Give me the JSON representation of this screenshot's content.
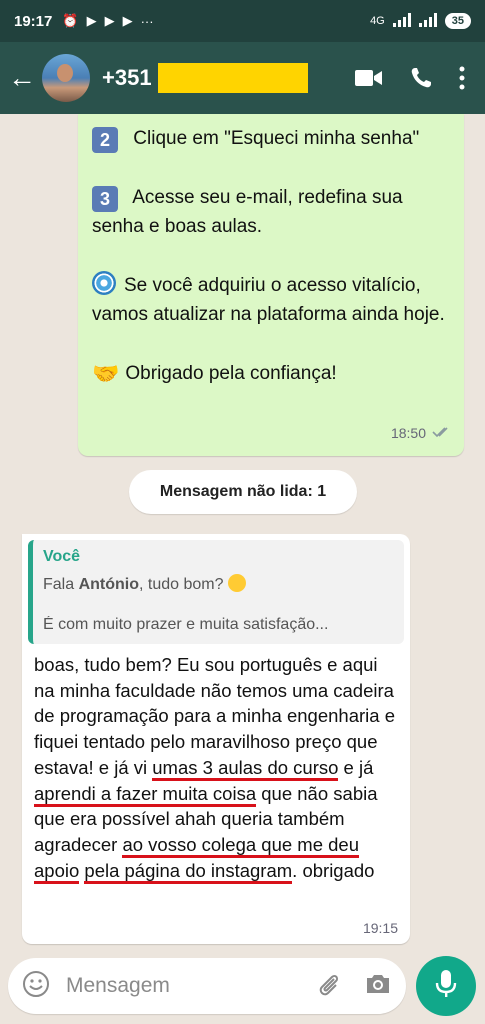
{
  "status_bar": {
    "time": "19:17",
    "network": "4G",
    "battery": "35"
  },
  "header": {
    "contact_name": "+351",
    "back_label": "←"
  },
  "messages": {
    "outgoing": {
      "step2_num": "2",
      "step2_text": "Clique em \"Esqueci minha senha\"",
      "step3_num": "3",
      "step3_text": "Acesse seu e-mail, redefina sua senha  e boas aulas.",
      "lifetime_text": "Se você adquiriu o acesso vitalício, vamos atualizar na plataforma ainda hoje.",
      "thanks_text": "Obrigado pela confiança!",
      "time": "18:50"
    },
    "unread_banner": "Mensagem não lida: 1",
    "incoming": {
      "quote_author": "Você",
      "quote_line1_pre": "Fala ",
      "quote_line1_name": "António",
      "quote_line1_post": ", tudo bom?",
      "quote_line2": "É  com muito  prazer e muita satisfação...",
      "text_1": "boas, tudo bem? Eu sou português e aqui na minha faculdade não temos uma cadeira de programação para a minha engenharia e fiquei tentado pelo maravilhoso preço que estava! e já vi ",
      "text_ul1": "umas 3 aulas do curso",
      "text_2": " e já ",
      "text_ul2": "aprendi a fazer muita coisa",
      "text_3": " que não sabia que era possível ahah queria também agradecer ",
      "text_ul3": "ao vosso colega que me deu apoio",
      "text_4": " ",
      "text_ul4": "pela página do instagram",
      "text_5": ". obrigado",
      "time": "19:15"
    }
  },
  "composer": {
    "placeholder": "Mensagem"
  },
  "colors": {
    "header": "#2a524c",
    "outgoing_bubble": "#dcf8c6",
    "accent": "#11a88a",
    "underline": "#d8111a"
  }
}
